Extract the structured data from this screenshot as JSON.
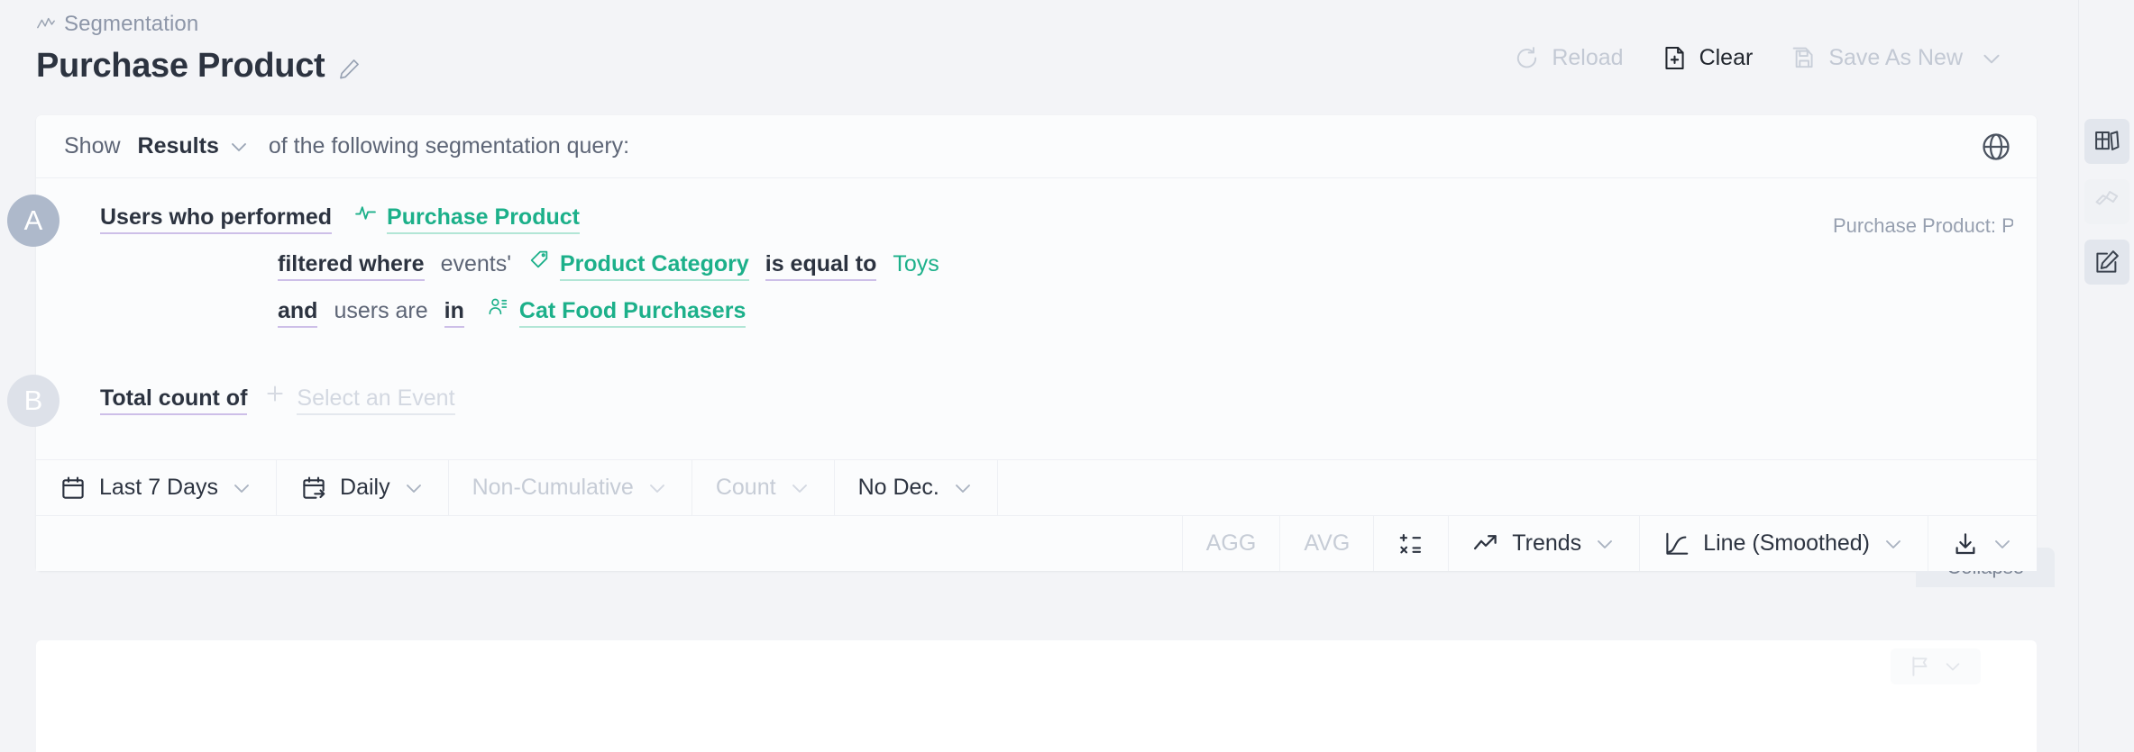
{
  "header": {
    "breadcrumb": "Segmentation",
    "breadcrumb_icon": "line-chart-icon",
    "title": "Purchase Product",
    "edit_icon": "pencil-icon",
    "actions": [
      {
        "label": "Reload",
        "icon": "reload-icon",
        "state": "disabled"
      },
      {
        "label": "Clear",
        "icon": "new-document-icon",
        "state": "active"
      },
      {
        "label": "Save As New",
        "icon": "save-icon",
        "state": "disabled",
        "chevron": true
      }
    ]
  },
  "query": {
    "show_label": "Show",
    "show_value": "Results",
    "show_tail": "of the following segmentation query:",
    "globe_icon": "globe-icon",
    "right_note": "Purchase Product: Pro",
    "collapse_label": "Collapse",
    "blocks": [
      {
        "badge": "A",
        "lines": [
          {
            "indent": false,
            "tokens": [
              {
                "text": "Users who performed",
                "style": "strong"
              },
              {
                "text": "Purchase Product",
                "style": "green",
                "icon": "event-line-icon"
              }
            ]
          },
          {
            "indent": true,
            "tokens": [
              {
                "text": "filtered where",
                "style": "strong"
              },
              {
                "text": "events'",
                "style": "plain"
              },
              {
                "text": "Product Category",
                "style": "green",
                "icon": "tag-icon"
              },
              {
                "text": "is equal to",
                "style": "strong"
              },
              {
                "text": "Toys",
                "style": "green-plain"
              }
            ]
          },
          {
            "indent": true,
            "tokens": [
              {
                "text": "and",
                "style": "strong"
              },
              {
                "text": "users are",
                "style": "plain"
              },
              {
                "text": "in",
                "style": "strong"
              },
              {
                "text": "Cat Food Purchasers",
                "style": "green",
                "icon": "cohort-users-icon"
              }
            ]
          }
        ]
      },
      {
        "badge": "B",
        "lines": [
          {
            "indent": false,
            "tokens": [
              {
                "text": "Total count of",
                "style": "strong"
              },
              {
                "text": "Select an Event",
                "style": "ghost",
                "icon": "plus-icon"
              }
            ]
          }
        ]
      }
    ]
  },
  "toolbar_primary": [
    {
      "label": "Last 7 Days",
      "icon": "calendar-icon",
      "chevron": true,
      "state": "active"
    },
    {
      "label": "Daily",
      "icon": "calendar-interval-icon",
      "chevron": true,
      "state": "active"
    },
    {
      "label": "Non-Cumulative",
      "icon": null,
      "chevron": true,
      "state": "muted"
    },
    {
      "label": "Count",
      "icon": null,
      "chevron": true,
      "state": "muted"
    },
    {
      "label": "No Dec.",
      "icon": null,
      "chevron": true,
      "state": "active"
    }
  ],
  "toolbar_secondary": [
    {
      "label": "AGG",
      "icon": null,
      "chevron": false,
      "state": "muted"
    },
    {
      "label": "AVG",
      "icon": null,
      "chevron": false,
      "state": "muted"
    },
    {
      "label": "",
      "icon": "formula-icon",
      "chevron": false,
      "state": "active"
    },
    {
      "label": "Trends",
      "icon": "trend-up-icon",
      "chevron": true,
      "state": "active"
    },
    {
      "label": "Line (Smoothed)",
      "icon": "line-smoothed-icon",
      "chevron": true,
      "state": "active"
    },
    {
      "label": "",
      "icon": "download-icon",
      "chevron": true,
      "state": "active"
    }
  ],
  "chart_pane": {
    "flag_icon": "flag-icon",
    "flag_chevron": true
  },
  "rail": [
    {
      "icon": "board-columns-icon",
      "state": "on"
    },
    {
      "icon": "telescope-icon",
      "state": "off"
    },
    {
      "icon": "note-edit-icon",
      "state": "on"
    }
  ],
  "colors": {
    "accent_green": "#1cb08a",
    "underline_purple": "#cdbfe8",
    "underline_green": "#b2e6d6",
    "badge_grey": "#aeb9cb",
    "page_bg": "#f3f4f7",
    "card_bg": "#fbfcfd"
  }
}
